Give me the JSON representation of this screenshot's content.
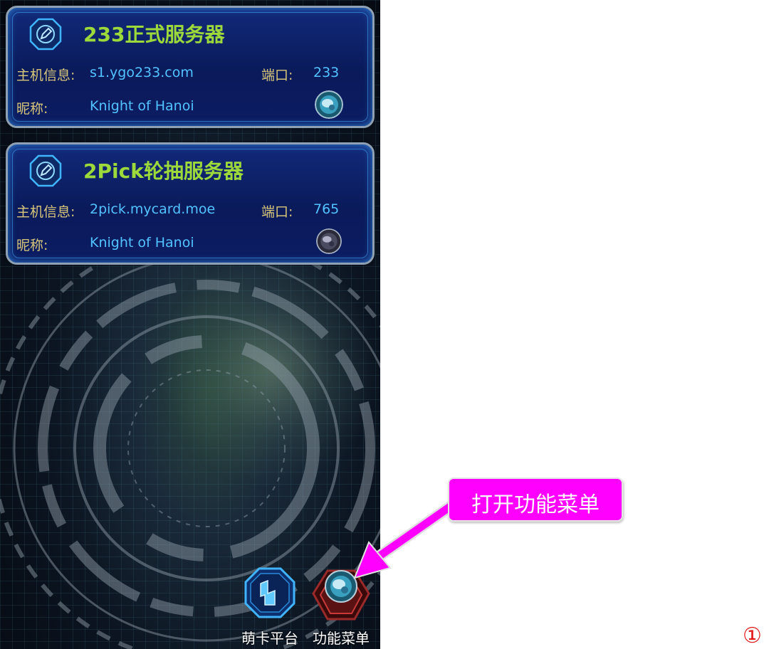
{
  "servers": [
    {
      "title": "233正式服务器",
      "host_label": "主机信息:",
      "host": "s1.ygo233.com",
      "port_label": "端口:",
      "port": "233",
      "nick_label": "昵称:",
      "nick": "Knight of Hanoi"
    },
    {
      "title": "2Pick轮抽服务器",
      "host_label": "主机信息:",
      "host": "2pick.mycard.moe",
      "port_label": "端口:",
      "port": "765",
      "nick_label": "昵称:",
      "nick": "Knight of Hanoi"
    }
  ],
  "bottom_bar": {
    "mycard_label": "萌卡平台",
    "menu_label": "功能菜单"
  },
  "annotation": {
    "callout_text": "打开功能菜单",
    "step_number": "①"
  },
  "colors": {
    "card_bg": "#0a1a5a",
    "title": "#9cd93a",
    "label": "#d8c77a",
    "value": "#52c3ff",
    "callout": "#ff00ff",
    "step": "#e01818"
  },
  "icons": [
    "edit-icon",
    "avatar-icon",
    "mycard-platform-icon",
    "function-menu-icon",
    "arrow-icon"
  ]
}
